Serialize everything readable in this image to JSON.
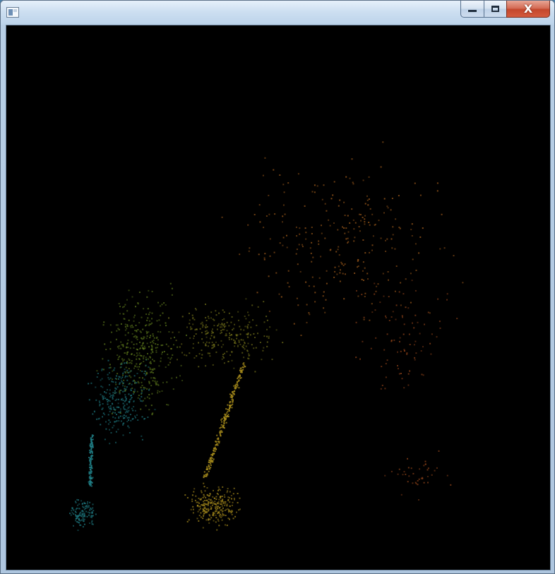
{
  "window": {
    "title": "",
    "icon": "application-window-icon",
    "controls": {
      "minimize_icon": "minimize-icon",
      "maximize_icon": "maximize-icon",
      "close_label": "X"
    }
  },
  "canvas": {
    "background": "#000000",
    "colors": {
      "cyan": "#1f7e86",
      "green": "#5e7a1c",
      "olive": "#7c7a1c",
      "yellow": "#a88c1c",
      "orange": "#a8601c",
      "red_orange": "#a04a1c"
    }
  }
}
